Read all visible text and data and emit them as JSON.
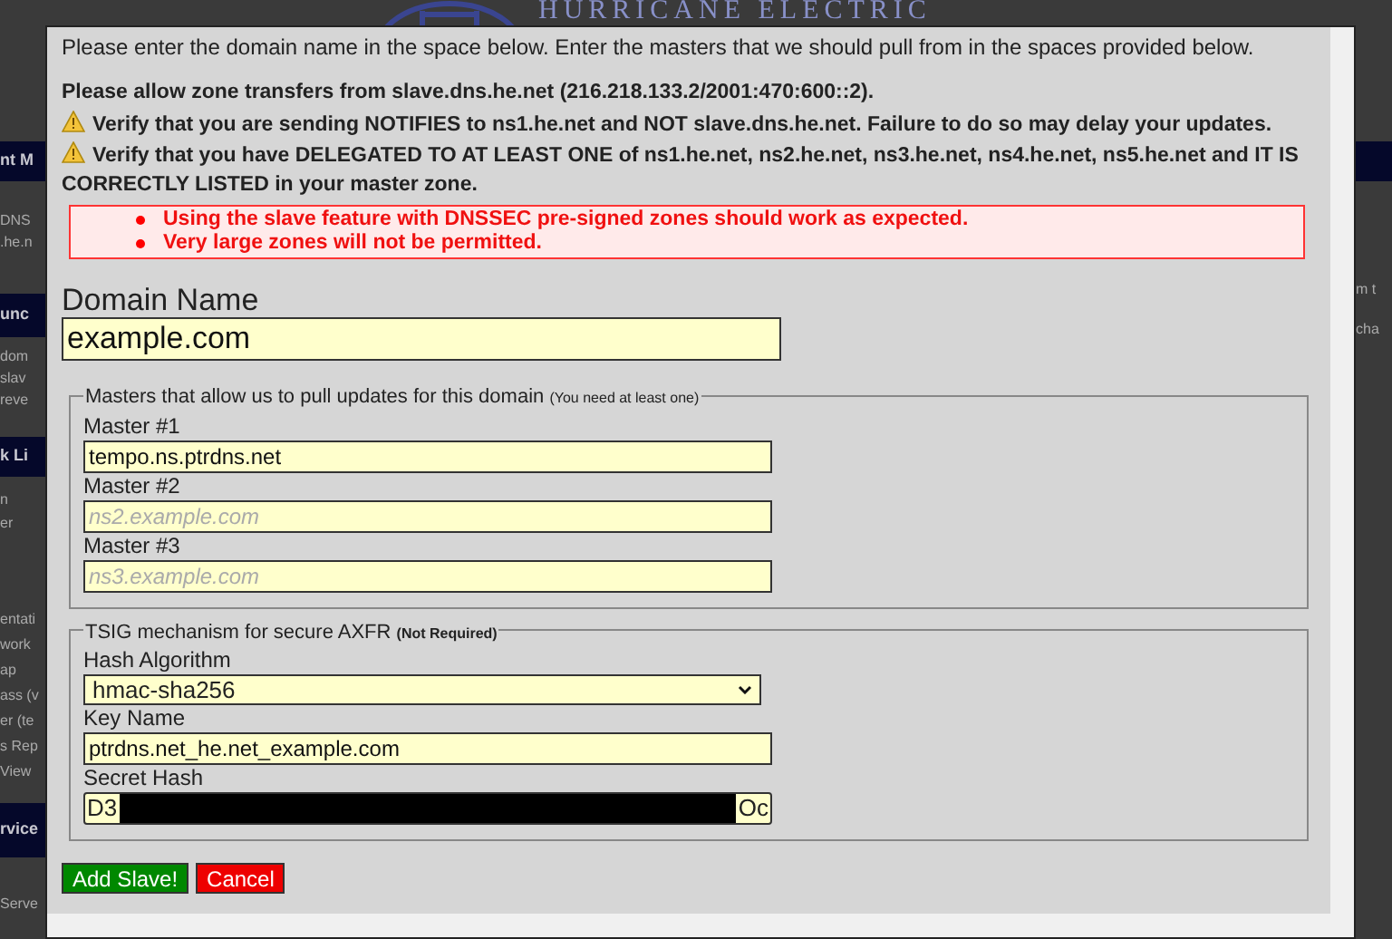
{
  "background": {
    "logo": "HURRICANE ELECTRIC",
    "left": [
      {
        "kind": "band",
        "text": "nt M"
      },
      {
        "kind": "text",
        "text": "DNS"
      },
      {
        "kind": "text",
        "text": ".he.n"
      },
      {
        "kind": "band",
        "text": "unc"
      },
      {
        "kind": "text",
        "text": "dom"
      },
      {
        "kind": "text",
        "text": "slav"
      },
      {
        "kind": "text",
        "text": "reve"
      },
      {
        "kind": "band",
        "text": "k Li"
      },
      {
        "kind": "text",
        "text": "n"
      },
      {
        "kind": "text",
        "text": "er"
      },
      {
        "kind": "text",
        "text": "entati"
      },
      {
        "kind": "text",
        "text": "work"
      },
      {
        "kind": "text",
        "text": "ap"
      },
      {
        "kind": "text",
        "text": "ass (v"
      },
      {
        "kind": "text",
        "text": "er (te"
      },
      {
        "kind": "text",
        "text": "s Rep"
      },
      {
        "kind": "text",
        "text": "View"
      },
      {
        "kind": "band",
        "text": "rvice"
      },
      {
        "kind": "text",
        "text": "Serve"
      }
    ],
    "right": [
      {
        "kind": "band"
      },
      {
        "kind": "text",
        "text": "m t"
      },
      {
        "kind": "text",
        "text": "cha"
      }
    ]
  },
  "dialog": {
    "intro": "Please enter the domain name in the space below. Enter the masters that we should pull from in the spaces provided below.",
    "notices": [
      {
        "kind": "plain",
        "text": "Please allow zone transfers from slave.dns.he.net (216.218.133.2/2001:470:600::2)."
      },
      {
        "kind": "warning",
        "text": "Verify that you are sending NOTIFIES to ns1.he.net and NOT slave.dns.he.net. Failure to do so may delay your updates."
      },
      {
        "kind": "warning",
        "text": "Verify that you have DELEGATED TO AT LEAST ONE of ns1.he.net, ns2.he.net, ns3.he.net, ns4.he.net, ns5.he.net and IT IS CORRECTLY LISTED in your master zone."
      }
    ],
    "alerts": [
      "Using the slave feature with DNSSEC pre-signed zones should work as expected.",
      "Very large zones will not be permitted."
    ],
    "domain": {
      "label": "Domain Name",
      "value": "example.com"
    },
    "masters": {
      "legend": "Masters that allow us to pull updates for this domain",
      "note": "(You need at least one)",
      "fields": [
        {
          "label": "Master #1",
          "value": "tempo.ns.ptrdns.net"
        },
        {
          "label": "Master #2",
          "placeholder": "ns2.example.com"
        },
        {
          "label": "Master #3",
          "placeholder": "ns3.example.com"
        }
      ]
    },
    "tsig": {
      "legend": "TSIG mechanism for secure AXFR",
      "note": "(Not Required)",
      "hash": {
        "label": "Hash Algorithm",
        "value": "hmac-sha256"
      },
      "key": {
        "label": "Key Name",
        "value": "ptrdns.net_he.net_example.com"
      },
      "secret": {
        "label": "Secret Hash",
        "start": "D3",
        "end": "Oc"
      }
    },
    "buttons": [
      {
        "kind": "submit",
        "label": "Add Slave!"
      },
      {
        "kind": "cancel",
        "label": "Cancel"
      }
    ]
  }
}
